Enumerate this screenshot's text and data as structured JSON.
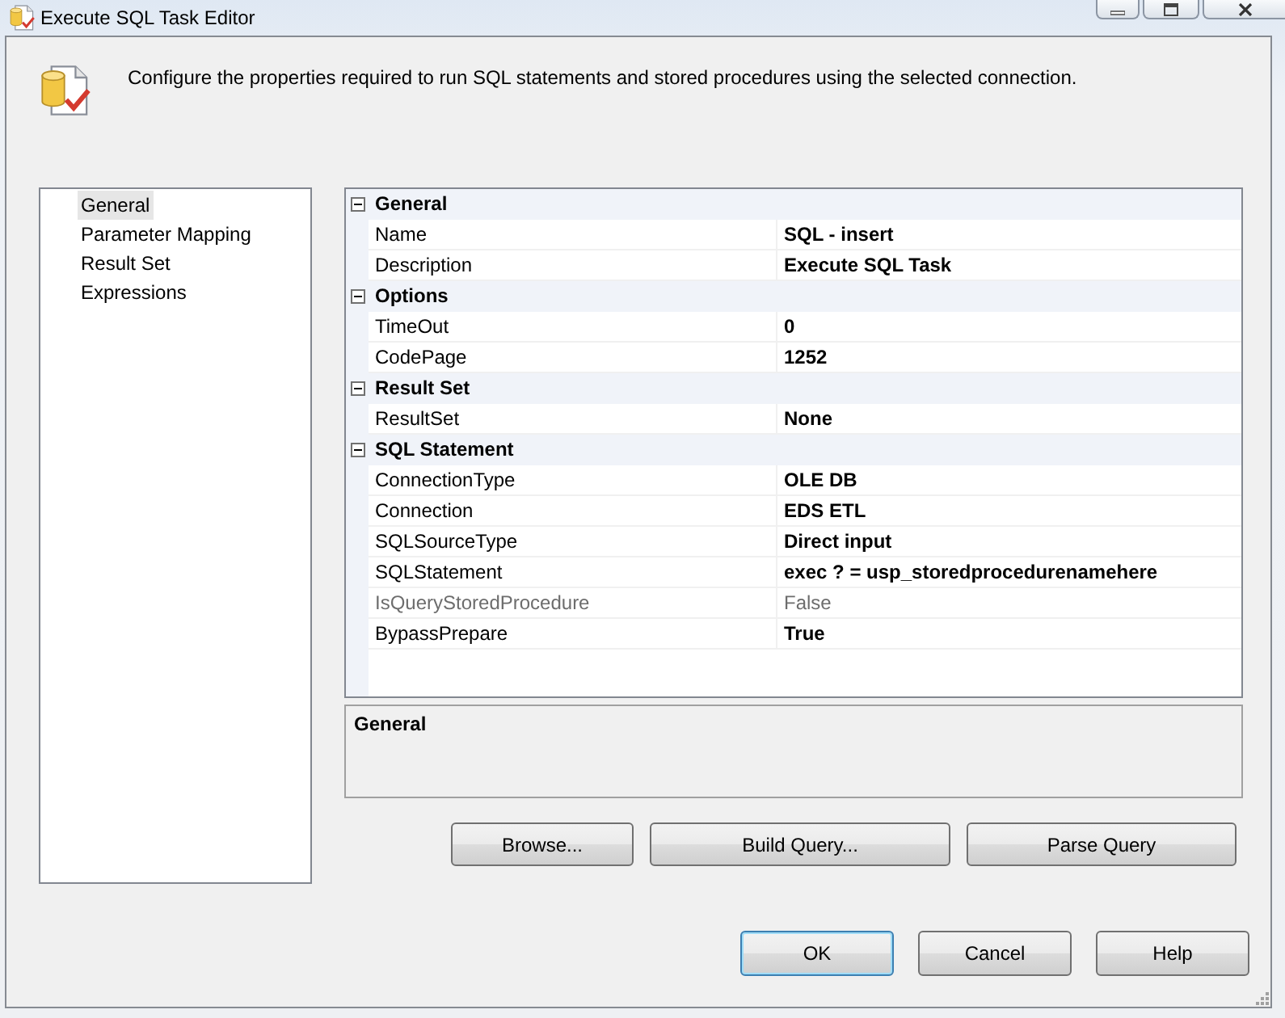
{
  "window": {
    "title": "Execute SQL Task Editor"
  },
  "header": {
    "description": "Configure the properties required to run SQL statements and stored procedures using the selected connection."
  },
  "pages": [
    {
      "label": "General",
      "selected": true
    },
    {
      "label": "Parameter Mapping",
      "selected": false
    },
    {
      "label": "Result Set",
      "selected": false
    },
    {
      "label": "Expressions",
      "selected": false
    }
  ],
  "properties": [
    {
      "category": "General",
      "expanded": true,
      "rows": [
        {
          "name": "Name",
          "value": "SQL - insert",
          "disabled": false
        },
        {
          "name": "Description",
          "value": "Execute SQL Task",
          "disabled": false
        }
      ]
    },
    {
      "category": "Options",
      "expanded": true,
      "rows": [
        {
          "name": "TimeOut",
          "value": "0",
          "disabled": false
        },
        {
          "name": "CodePage",
          "value": "1252",
          "disabled": false
        }
      ]
    },
    {
      "category": "Result Set",
      "expanded": true,
      "rows": [
        {
          "name": "ResultSet",
          "value": "None",
          "disabled": false
        }
      ]
    },
    {
      "category": "SQL Statement",
      "expanded": true,
      "rows": [
        {
          "name": "ConnectionType",
          "value": "OLE DB",
          "disabled": false
        },
        {
          "name": "Connection",
          "value": "EDS ETL",
          "disabled": false
        },
        {
          "name": "SQLSourceType",
          "value": "Direct input",
          "disabled": false
        },
        {
          "name": "SQLStatement",
          "value": "exec ? = usp_storedprocedurenamehere",
          "disabled": false
        },
        {
          "name": "IsQueryStoredProcedure",
          "value": "False",
          "disabled": true
        },
        {
          "name": "BypassPrepare",
          "value": "True",
          "disabled": false
        }
      ]
    }
  ],
  "description_panel": {
    "title": "General"
  },
  "query_buttons": [
    "Browse...",
    "Build Query...",
    "Parse Query"
  ],
  "dialog_buttons": [
    {
      "label": "OK",
      "default": true
    },
    {
      "label": "Cancel",
      "default": false
    },
    {
      "label": "Help",
      "default": false
    }
  ]
}
